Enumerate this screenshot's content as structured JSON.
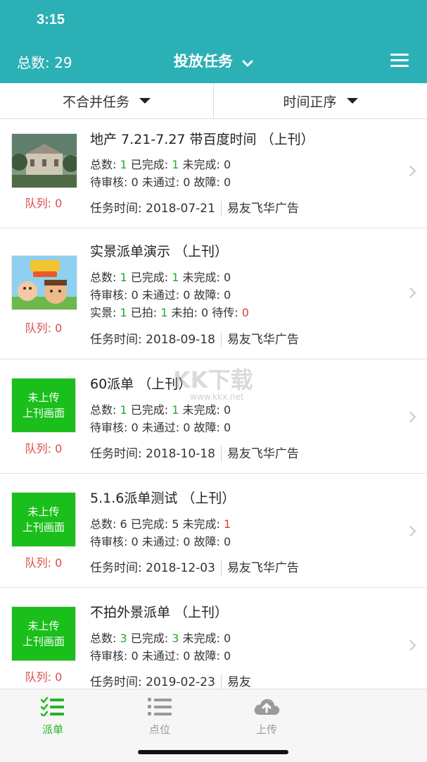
{
  "status_bar": {
    "time": "3:15"
  },
  "header": {
    "total_label": "总数: 29",
    "title": "投放任务",
    "colors": {
      "bar": "#2bb0b6"
    }
  },
  "filters": {
    "merge": "不合并任务",
    "sort": "时间正序"
  },
  "tasks": [
    {
      "title": "地产 7.21-7.27 带百度时间 （上刊）",
      "queue": "队列: 0",
      "stats_line1": {
        "total_l": "总数: ",
        "total": "1",
        "done_l": " 已完成: ",
        "done": "1",
        "undone_l": " 未完成: ",
        "undone": "0"
      },
      "stats_line2": "待审核: 0  未通过: 0  故障: 0",
      "time": "任务时间: 2018-07-21",
      "company": "易友飞华广告"
    },
    {
      "title": "实景派单演示 （上刊）",
      "queue": "队列: 0",
      "stats_line1": {
        "total_l": "总数: ",
        "total": "1",
        "done_l": " 已完成: ",
        "done": "1",
        "undone_l": " 未完成: ",
        "undone": "0"
      },
      "stats_line2": "待审核: 0  未通过: 0  故障: 0",
      "stats_line3": {
        "real_l": "实景: ",
        "real": "1",
        "shot_l": " 已拍: ",
        "shot": "1",
        "unshot_l": " 未拍: 0  待传: ",
        "pending": "0"
      },
      "time": "任务时间: 2018-09-18",
      "company": "易友飞华广告"
    },
    {
      "title": "60派单 （上刊）",
      "thumb_text1": "未上传",
      "thumb_text2": "上刊画面",
      "queue": "队列: 0",
      "stats_line1": {
        "total_l": "总数: ",
        "total": "1",
        "done_l": " 已完成: ",
        "done": "1",
        "undone_l": " 未完成: ",
        "undone": "0"
      },
      "stats_line2": "待审核: 0  未通过: 0  故障: 0",
      "time": "任务时间: 2018-10-18",
      "company": "易友飞华广告"
    },
    {
      "title": "5.1.6派单测试 （上刊）",
      "thumb_text1": "未上传",
      "thumb_text2": "上刊画面",
      "queue": "队列: 0",
      "stats_line1": {
        "total_l": "总数: ",
        "total": "6",
        "done_l": " 已完成: ",
        "done": "5",
        "undone_l": " 未完成: ",
        "undone": "1"
      },
      "stats_line2": "待审核: 0  未通过: 0  故障: 0",
      "time": "任务时间: 2018-12-03",
      "company": "易友飞华广告"
    },
    {
      "title": "不拍外景派单 （上刊）",
      "thumb_text1": "未上传",
      "thumb_text2": "上刊画面",
      "queue": "队列: 0",
      "stats_line1": {
        "total_l": "总数: ",
        "total": "3",
        "done_l": " 已完成: ",
        "done": "3",
        "undone_l": " 未完成: ",
        "undone": "0"
      },
      "stats_line2": "待审核: 0  未通过: 0  故障: 0",
      "time": "任务时间: 2019-02-23",
      "company": "易友"
    }
  ],
  "tabbar": {
    "dispatch": "派单",
    "points": "点位",
    "upload": "上传"
  },
  "watermark": {
    "main": "KK下载",
    "url": "www.kkx.net"
  }
}
